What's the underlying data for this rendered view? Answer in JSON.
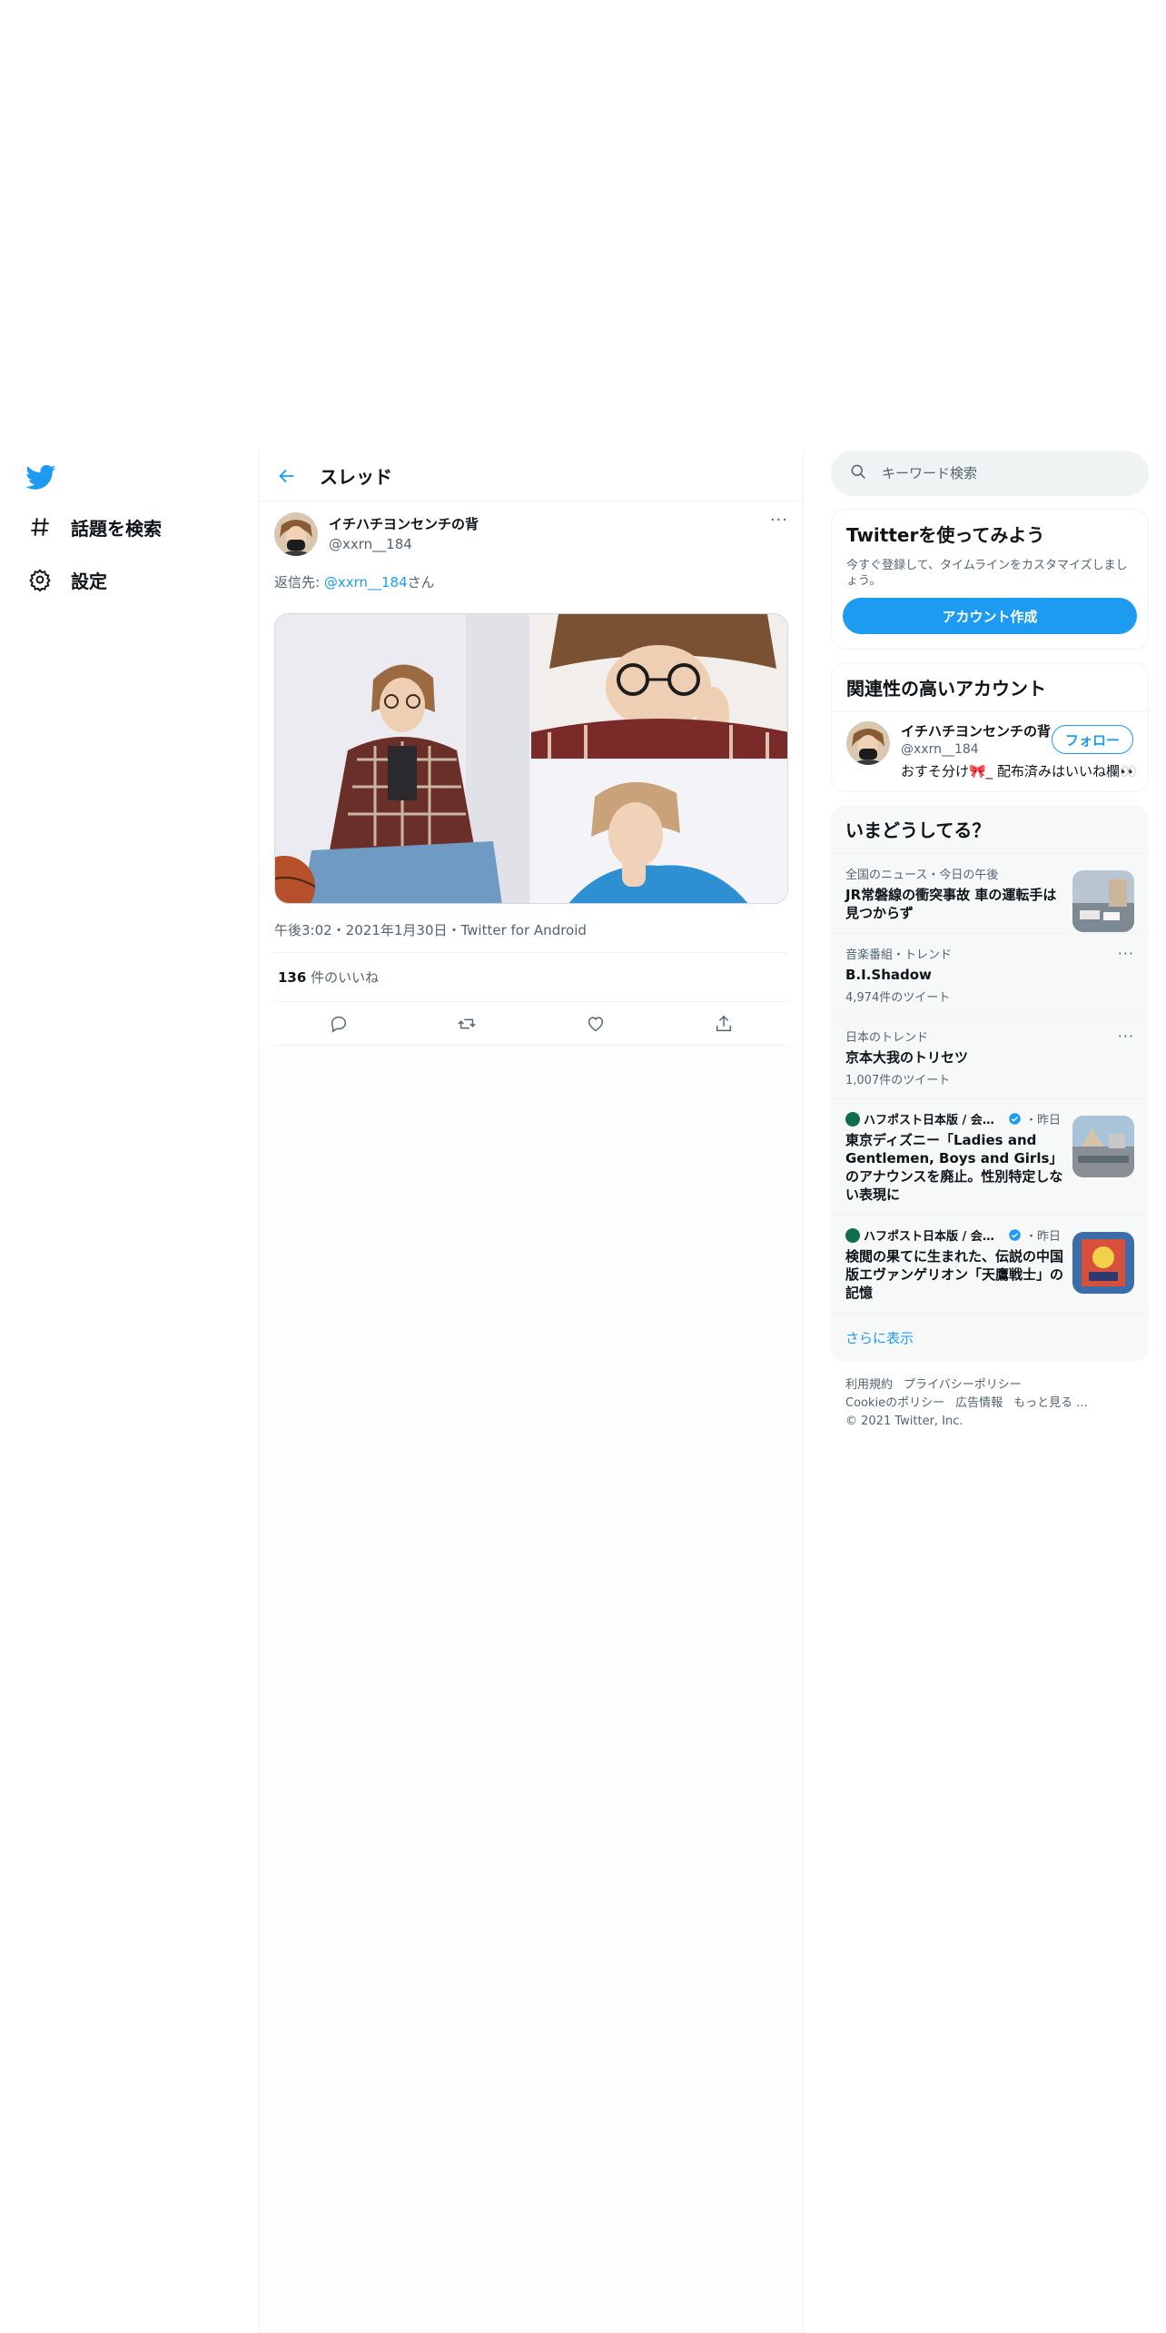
{
  "nav": {
    "items": [
      {
        "label": "話題を検索",
        "icon": "hashtag-icon"
      },
      {
        "label": "設定",
        "icon": "gear-icon"
      }
    ]
  },
  "thread": {
    "title": "スレッド",
    "tweet": {
      "display_name": "イチハチヨンセンチの背",
      "handle": "@xxrn__184",
      "reply_prefix": "返信先: ",
      "reply_mention": "@xxrn__184",
      "reply_suffix": "さん",
      "timestamp": "午後3:02・2021年1月30日・Twitter for Android",
      "likes_count": "136",
      "likes_label": " 件のいいね",
      "more": "···"
    }
  },
  "search": {
    "placeholder": "キーワード検索"
  },
  "signup": {
    "title": "Twitterを使ってみよう",
    "description": "今すぐ登録して、タイムラインをカスタマイズしましょう。",
    "button": "アカウント作成"
  },
  "recommended": {
    "title": "関連性の高いアカウント",
    "account": {
      "name": "イチハチヨンセンチの背",
      "handle": "@xxrn__184",
      "bio": "おすそ分け🎀_ 配布済みはいいね欄👀",
      "follow": "フォロー"
    }
  },
  "trends": {
    "title": "いまどうしてる？",
    "items": [
      {
        "context": "全国のニュース・今日の午後",
        "title": "JR常磐線の衝突事故 車の運転手は見つからず"
      },
      {
        "context": "音楽番組・トレンド",
        "title": "B.I.Shadow",
        "count": "4,974件のツイート"
      },
      {
        "context": "日本のトレンド",
        "title": "京本大我のトリセツ",
        "count": "1,007件のツイート"
      },
      {
        "publisher": "ハフポスト日本版 / 会話...",
        "time": "・昨日",
        "title": "東京ディズニー「Ladies and Gentlemen, Boys and Girls」のアナウンスを廃止。性別特定しない表現に"
      },
      {
        "publisher": "ハフポスト日本版 / 会話...",
        "time": "・昨日",
        "title": "検閲の果てに生まれた、伝説の中国版エヴァンゲリオン「天鷹戦士」の記憶"
      }
    ],
    "show_more": "さらに表示"
  },
  "footer": {
    "links": [
      "利用規約",
      "プライバシーポリシー",
      "Cookieのポリシー",
      "広告情報",
      "もっと見る ..."
    ],
    "copyright": "© 2021 Twitter, Inc."
  },
  "colors": {
    "accent": "#1d9bf0",
    "text": "#0f1419",
    "secondary": "#536471"
  }
}
